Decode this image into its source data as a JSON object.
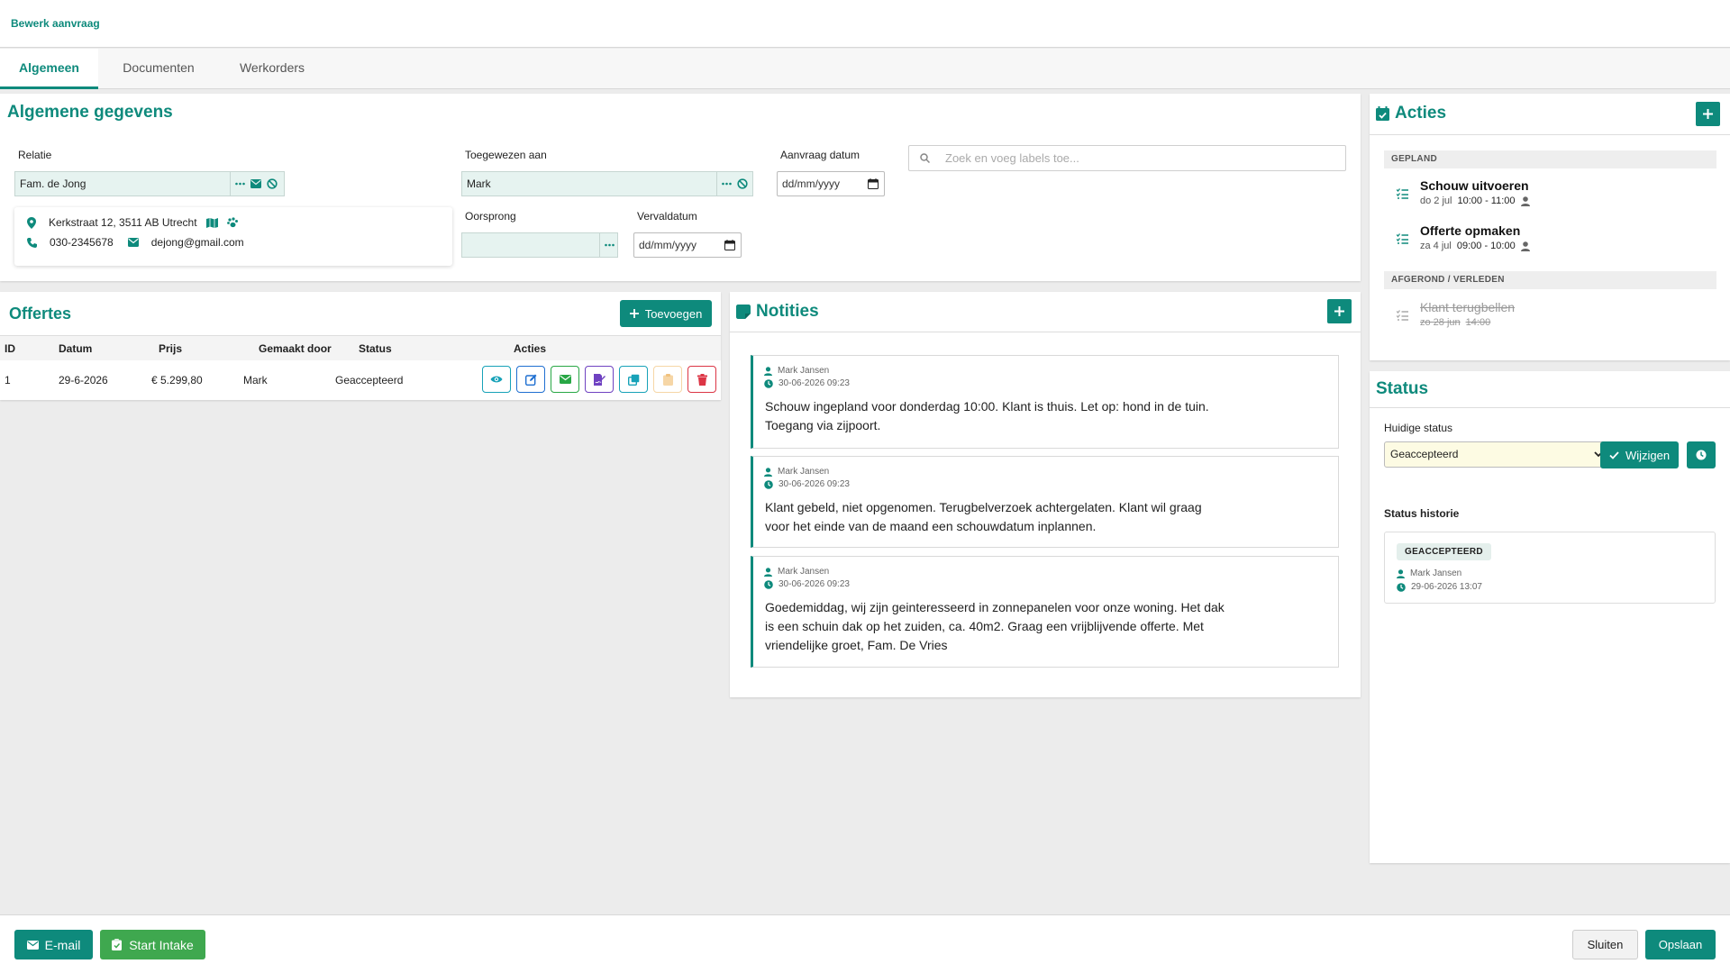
{
  "header": {
    "title": "Bewerk aanvraag"
  },
  "tabs": [
    {
      "label": "Algemeen"
    },
    {
      "label": "Documenten"
    },
    {
      "label": "Werkorders"
    }
  ],
  "general": {
    "title": "Algemene gegevens",
    "relatie_label": "Relatie",
    "relatie_value": "Fam. de Jong",
    "address": "Kerkstraat 12, 3511 AB Utrecht",
    "phone": "030-2345678",
    "email": "dejong@gmail.com",
    "toegewezen_label": "Toegewezen aan",
    "toegewezen_value": "Mark",
    "oorsprong_label": "Oorsprong",
    "oorsprong_value": "",
    "aanvraag_label": "Aanvraag datum",
    "aanvraag_value": "dd/mm/yyyy",
    "verval_label": "Vervaldatum",
    "verval_value": "dd/mm/yyyy",
    "labels_placeholder": "Zoek en voeg labels toe..."
  },
  "offertes": {
    "title": "Offertes",
    "add_label": "Toevoegen",
    "columns": [
      "ID",
      "Datum",
      "Prijs",
      "Gemaakt door",
      "Status",
      "Acties"
    ],
    "rows": [
      {
        "id": "1",
        "datum": "29-6-2026",
        "prijs": "€ 5.299,80",
        "door": "Mark",
        "status": "Geaccepteerd"
      }
    ]
  },
  "notities": {
    "title": "Notities",
    "items": [
      {
        "author": "Mark Jansen",
        "date": "30-06-2026 09:23",
        "line1": "Schouw ingepland voor donderdag 10:00. Klant is thuis. Let op: hond in de tuin.",
        "line2": "Toegang via zijpoort.",
        "line3": ""
      },
      {
        "author": "Mark Jansen",
        "date": "30-06-2026 09:23",
        "line1": "Klant gebeld, niet opgenomen. Terugbelverzoek achtergelaten. Klant wil graag",
        "line2": "voor het einde van de maand een schouwdatum inplannen.",
        "line3": ""
      },
      {
        "author": "Mark Jansen",
        "date": "30-06-2026 09:23",
        "line1": "Goedemiddag, wij zijn geinteresseerd in zonnepanelen voor onze woning. Het dak",
        "line2": "is een schuin dak op het zuiden, ca. 40m2. Graag een vrijblijvende offerte. Met",
        "line3": "vriendelijke groet, Fam. De Vries"
      }
    ]
  },
  "acties": {
    "title": "Acties",
    "planned_header": "GEPLAND",
    "planned": [
      {
        "title": "Schouw uitvoeren",
        "day": "do 2 jul",
        "time": "10:00 - 11:00"
      },
      {
        "title": "Offerte opmaken",
        "day": "za 4 jul",
        "time": "09:00 - 10:00"
      }
    ],
    "done_header": "AFGEROND / VERLEDEN",
    "done": [
      {
        "title": "Klant terugbellen",
        "day": "zo 28 jun",
        "time": "14:00"
      }
    ]
  },
  "status": {
    "title": "Status",
    "current_label": "Huidige status",
    "current_value": "Geaccepteerd",
    "change_label": "Wijzigen",
    "history_label": "Status historie",
    "history": [
      {
        "badge": "GEACCEPTEERD",
        "user": "Mark Jansen",
        "date": "29-06-2026 13:07"
      }
    ]
  },
  "footer": {
    "email_label": "E-mail",
    "intake_label": "Start Intake",
    "close_label": "Sluiten",
    "save_label": "Opslaan"
  },
  "colors": {
    "accent": "#0e8a7c",
    "green": "#3fa84f",
    "danger": "#dc3545",
    "purple": "#6f42c1",
    "info": "#17a2b8",
    "warning": "#f0ad4e"
  }
}
